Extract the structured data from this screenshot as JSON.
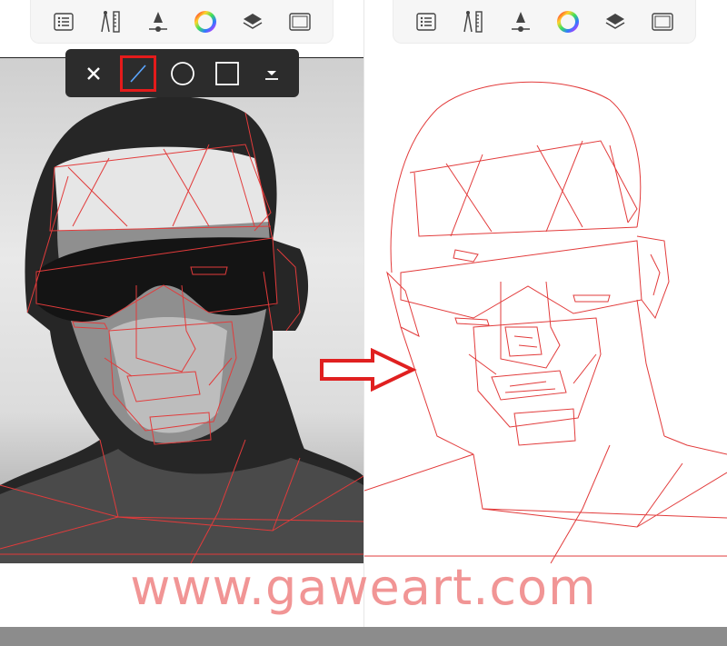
{
  "toolbar_icons": [
    "list-icon",
    "compass-ruler-icon",
    "brush-size-icon",
    "color-wheel-icon",
    "layers-icon",
    "fullscreen-icon"
  ],
  "draw_tools": {
    "items": [
      "close-icon",
      "line-tool-icon",
      "ellipse-tool-icon",
      "rectangle-tool-icon",
      "dropdown-icon"
    ],
    "selected": "line-tool-icon"
  },
  "colors": {
    "sketch_line": "#e23b3b",
    "selection_highlight": "#e41b1b",
    "toolbar_bg": "#2c2c2c",
    "watermark": "#f08a8a",
    "arrow": "#e02020"
  },
  "watermark": {
    "text": "www.gaweart.com"
  }
}
